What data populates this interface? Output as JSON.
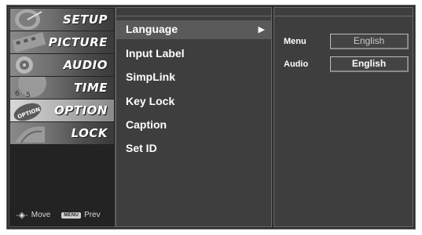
{
  "categories": [
    {
      "label": "SETUP",
      "icon": "satellite-dish-icon",
      "selected": false
    },
    {
      "label": "PICTURE",
      "icon": "film-strip-icon",
      "selected": false
    },
    {
      "label": "AUDIO",
      "icon": "speaker-icon",
      "selected": false
    },
    {
      "label": "TIME",
      "icon": "clock-icon",
      "selected": false
    },
    {
      "label": "OPTION",
      "icon": "option-tag-icon",
      "selected": true
    },
    {
      "label": "LOCK",
      "icon": "lock-icon",
      "selected": false
    }
  ],
  "nav_hints": {
    "move_label": "Move",
    "menu_key": "MENU",
    "prev_label": "Prev"
  },
  "submenu": {
    "items": [
      "Language",
      "Input Label",
      "SimpLink",
      "Key Lock",
      "Caption",
      "Set ID"
    ],
    "selected": "Language",
    "arrow": "▶"
  },
  "options": {
    "menu_label": "Menu",
    "menu_value": "English",
    "audio_label": "Audio",
    "audio_value": "English"
  },
  "colors": {
    "panel_bg": "#2c2c2c",
    "column_bg": "#3e3e3e",
    "selected_row": "#5a5a5a",
    "text": "#ffffff"
  }
}
